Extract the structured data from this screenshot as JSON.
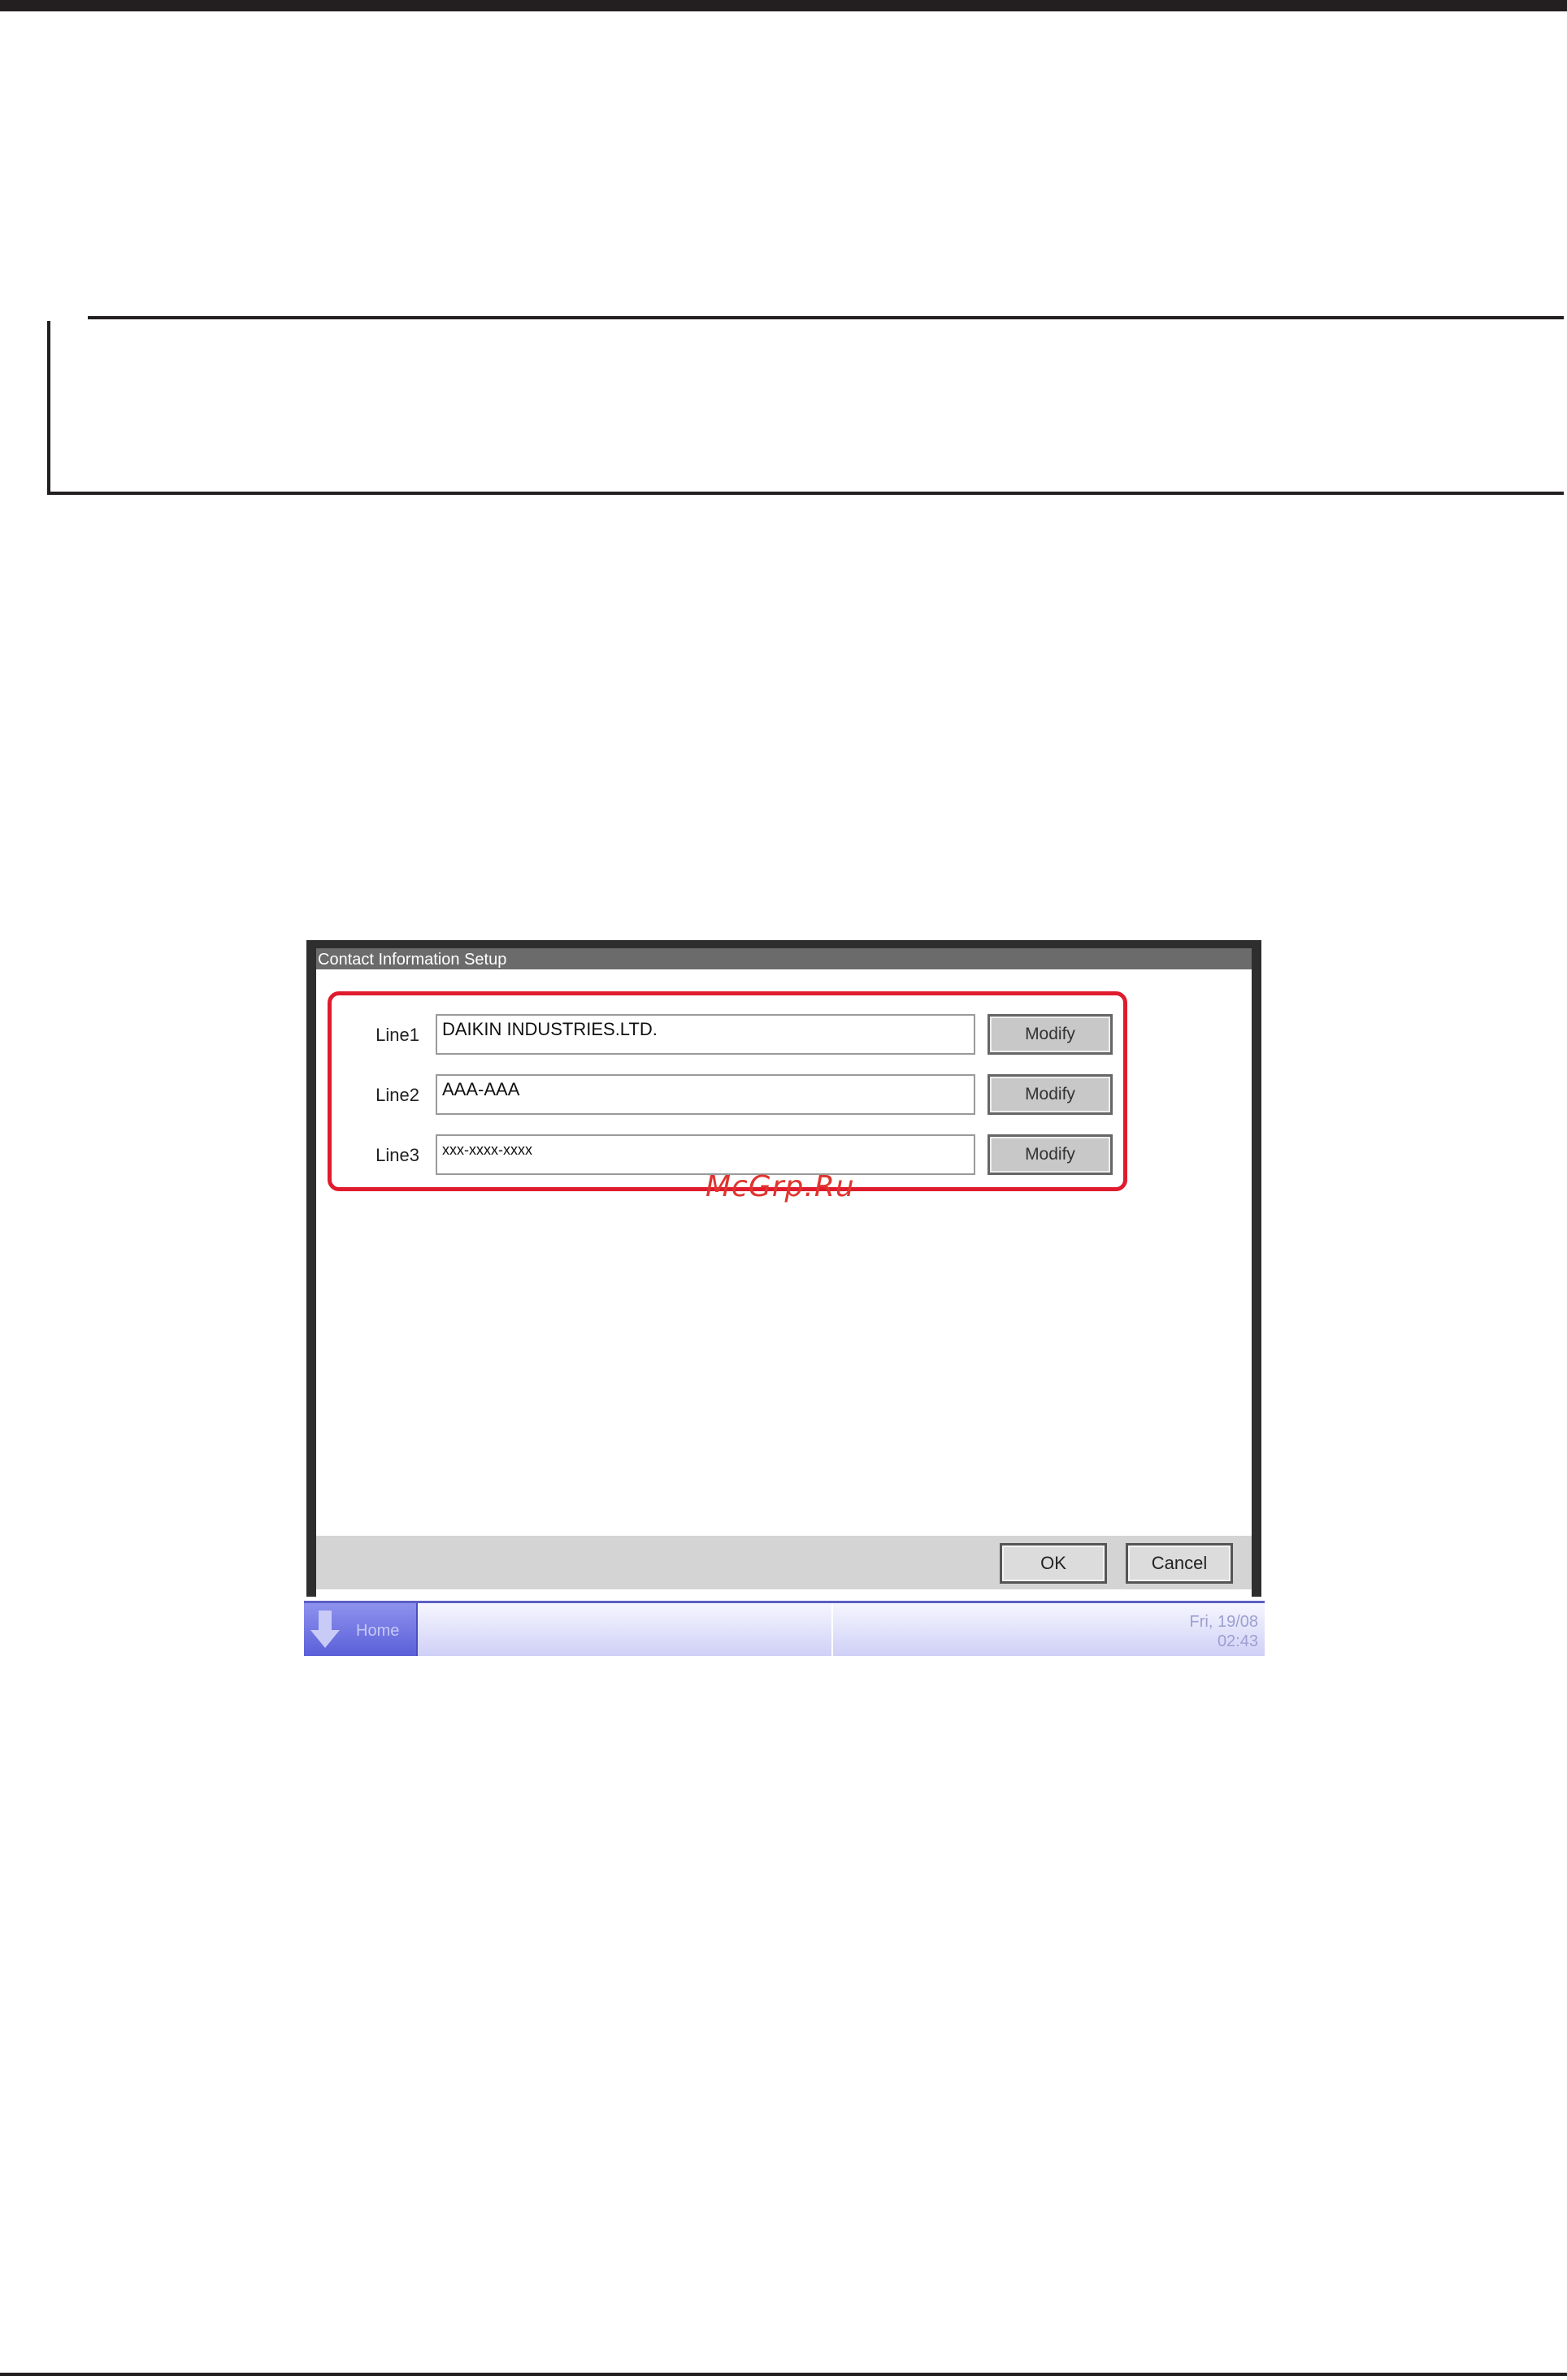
{
  "window": {
    "title": "Contact Information Setup"
  },
  "lines": [
    {
      "label": "Line1",
      "value": "DAIKIN INDUSTRIES.LTD.",
      "button": "Modify"
    },
    {
      "label": "Line2",
      "value": "AAA-AAA",
      "button": "Modify"
    },
    {
      "label": "Line3",
      "value": "xxx-xxxx-xxxx",
      "button": "Modify"
    }
  ],
  "footer": {
    "ok_label": "OK",
    "cancel_label": "Cancel"
  },
  "status_bar": {
    "home_label": "Home",
    "date": "Fri, 19/08",
    "time": "02:43"
  },
  "watermark": "McGrp.Ru",
  "colors": {
    "highlight_frame": "#e01b2e",
    "title_bar": "#6b6b6b",
    "status_accent": "#5b5fc4"
  }
}
